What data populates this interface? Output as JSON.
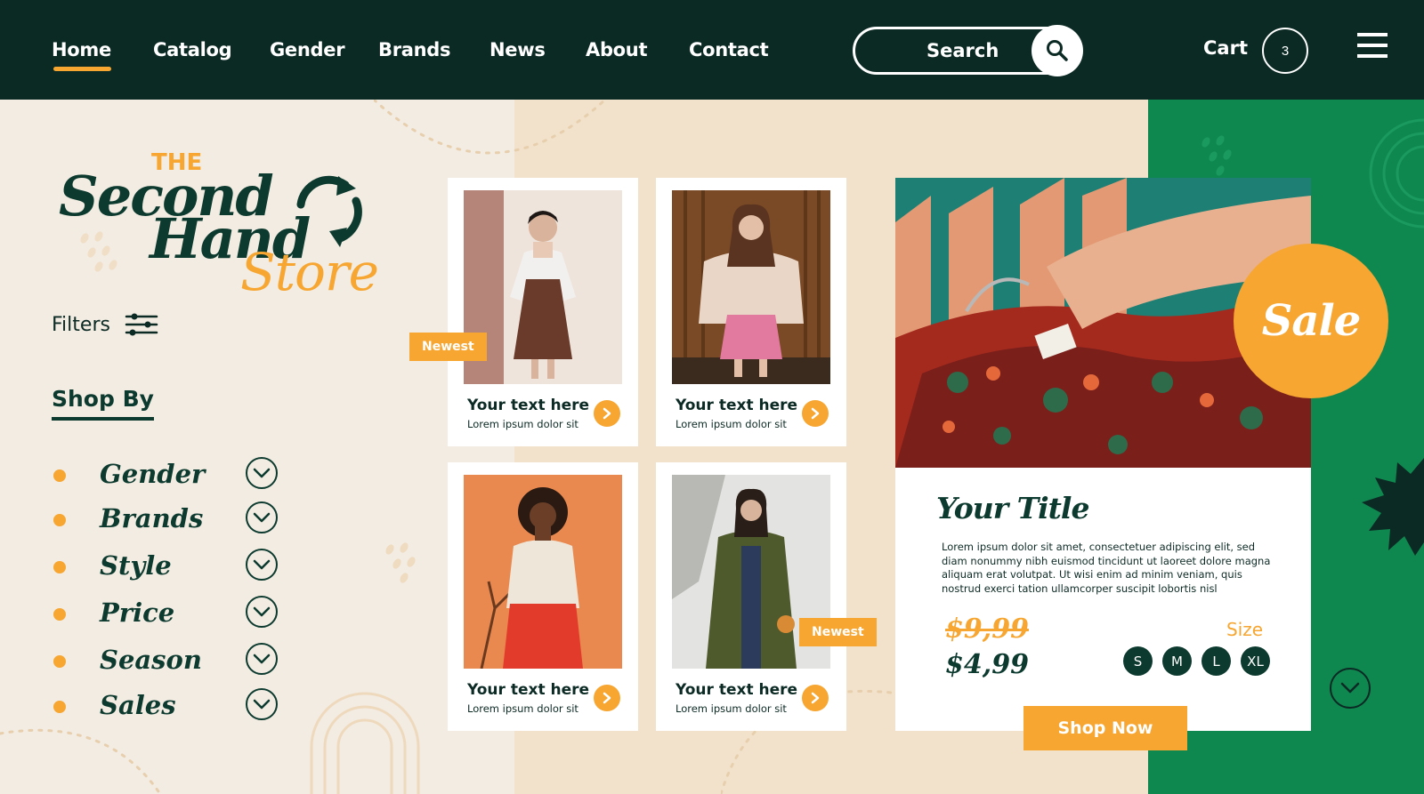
{
  "nav": {
    "links": [
      "Home",
      "Catalog",
      "Gender",
      "Brands",
      "News",
      "About",
      "Contact"
    ],
    "active": "Home",
    "search_label": "Search",
    "cart_label": "Cart",
    "cart_count": "3"
  },
  "brand": {
    "line1": "THE",
    "line2": "Second",
    "line3": "Hand",
    "line4": "Store"
  },
  "sidebar": {
    "filters_label": "Filters",
    "shop_by_label": "Shop By",
    "items": [
      "Gender",
      "Brands",
      "Style",
      "Price",
      "Season",
      "Sales"
    ]
  },
  "products": [
    {
      "title": "Your text here",
      "subtitle": "Lorem ipsum dolor sit",
      "badge": "Newest"
    },
    {
      "title": "Your text here",
      "subtitle": "Lorem ipsum dolor sit"
    },
    {
      "title": "Your text here",
      "subtitle": "Lorem ipsum dolor sit"
    },
    {
      "title": "Your text here",
      "subtitle": "Lorem ipsum dolor sit",
      "badge": "Newest"
    }
  ],
  "feature": {
    "sale_label": "Sale",
    "title": "Your Title",
    "description": "Lorem ipsum dolor sit amet, consectetuer adipiscing elit, sed diam nonummy nibh euismod tincidunt ut laoreet dolore magna aliquam erat volutpat. Ut wisi enim ad minim veniam, quis nostrud exerci tation ullamcorper suscipit lobortis nisl",
    "old_price": "$9,99",
    "new_price": "$4,99",
    "size_label": "Size",
    "sizes": [
      "S",
      "M",
      "L",
      "XL"
    ],
    "cta": "Shop Now"
  },
  "colors": {
    "dark_green": "#0c2a24",
    "brand_green": "#0f8850",
    "accent_orange": "#f6a631",
    "cream": "#f3ece3",
    "beige": "#f2e2cb"
  }
}
